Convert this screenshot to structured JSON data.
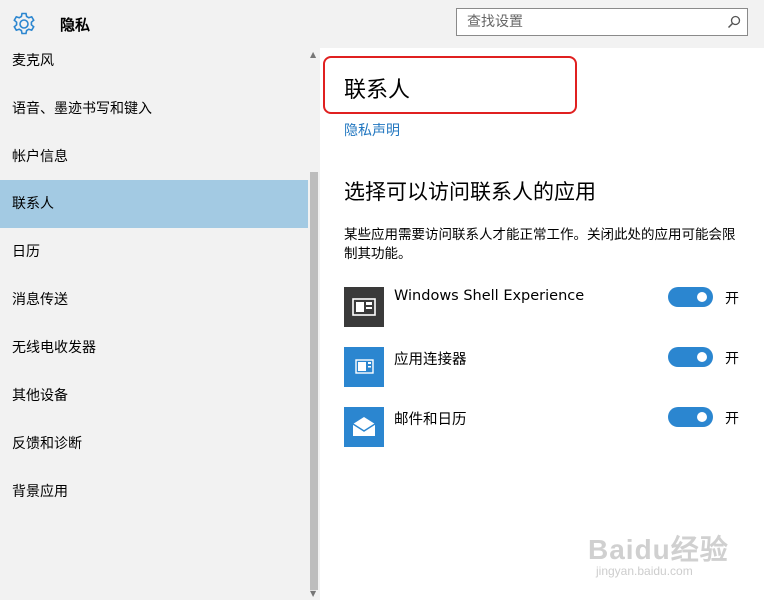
{
  "header": {
    "title": "隐私",
    "settings_icon": "gear-icon",
    "search": {
      "placeholder": "查找设置",
      "value": "",
      "icon": "search-icon"
    }
  },
  "sidebar": {
    "items": [
      {
        "label": "麦克风",
        "selected": false
      },
      {
        "label": "语音、墨迹书写和键入",
        "selected": false
      },
      {
        "label": "帐户信息",
        "selected": false
      },
      {
        "label": "联系人",
        "selected": true
      },
      {
        "label": "日历",
        "selected": false
      },
      {
        "label": "消息传送",
        "selected": false
      },
      {
        "label": "无线电收发器",
        "selected": false
      },
      {
        "label": "其他设备",
        "selected": false
      },
      {
        "label": "反馈和诊断",
        "selected": false
      },
      {
        "label": "背景应用",
        "selected": false
      }
    ],
    "selected_color": "#a3cae3"
  },
  "main": {
    "title": "联系人",
    "privacy_link": "隐私声明",
    "section_title": "选择可以访问联系人的应用",
    "section_desc": "某些应用需要访问联系人才能正常工作。关闭此处的应用可能会限制其功能。",
    "apps": [
      {
        "name": "Windows Shell Experience",
        "toggle_label": "开",
        "on": true,
        "icon": "shell-experience-icon",
        "icon_bg": "#3a3a3a"
      },
      {
        "name": "应用连接器",
        "toggle_label": "开",
        "on": true,
        "icon": "app-connector-icon",
        "icon_bg": "#2b86d0"
      },
      {
        "name": "邮件和日历",
        "toggle_label": "开",
        "on": true,
        "icon": "mail-calendar-icon",
        "icon_bg": "#2b86d0"
      }
    ],
    "toggle_color": "#2b86d0",
    "link_color": "#2277c0"
  },
  "watermark": {
    "text": "Baidu经验",
    "sub": "jingyan.baidu.com"
  }
}
